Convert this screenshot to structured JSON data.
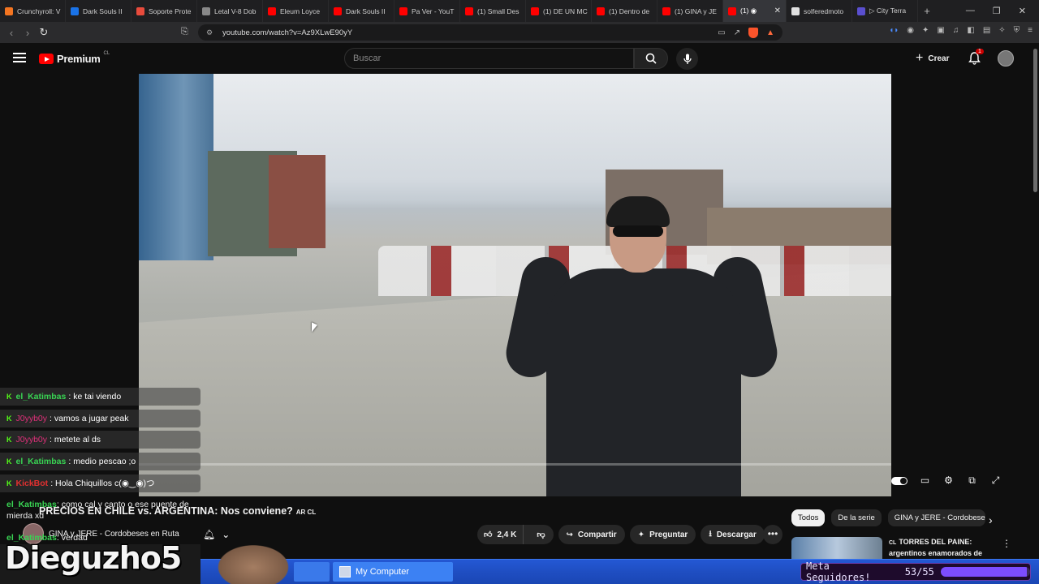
{
  "browser": {
    "tabs": [
      {
        "title": "Crunchyroll: V",
        "color": "#f47521"
      },
      {
        "title": "Dark Souls II",
        "color": "#1a73e8"
      },
      {
        "title": "Soporte Prote",
        "color": "#e84b3c"
      },
      {
        "title": "Letal V-8 Dob",
        "color": "#888888"
      },
      {
        "title": "Eleum Loyce",
        "color": "#ff0000"
      },
      {
        "title": "Dark Souls II",
        "color": "#ff0000"
      },
      {
        "title": "Pa Ver - YouT",
        "color": "#ff0000"
      },
      {
        "title": "(1) Small Des",
        "color": "#ff0000"
      },
      {
        "title": "(1) DE UN MC",
        "color": "#ff0000"
      },
      {
        "title": "(1) Dentro de",
        "color": "#ff0000"
      },
      {
        "title": "(1) GINA y JE",
        "color": "#ff0000"
      },
      {
        "title": "(1) ◉",
        "color": "#ff0000",
        "active": true
      },
      {
        "title": "solferedmoto",
        "color": "#e0e0e0"
      },
      {
        "title": "▷ City Terra",
        "color": "#5a4fcf"
      }
    ],
    "new_tab": "+",
    "url": "youtube.com/watch?v=Az9XLwE90yY"
  },
  "youtube": {
    "logo_text": "Premium",
    "country": "CL",
    "search_placeholder": "Buscar",
    "create_label": "Crear",
    "notification_count": "1"
  },
  "chat": [
    {
      "user": "el_Katimbas",
      "style": "u1",
      "message": ": ke tai viendo"
    },
    {
      "user": "J0yyb0y",
      "style": "u2",
      "message": ": vamos a jugar peak"
    },
    {
      "user": "J0yyb0y",
      "style": "u2",
      "message": ": metete al ds"
    },
    {
      "user": "el_Katimbas",
      "style": "u1",
      "message": ": medio pescao ;o"
    },
    {
      "user": "KickBot",
      "style": "u3",
      "message": ": Hola Chiquillos c(◉‿◉)つ"
    }
  ],
  "chat_multi": {
    "user": "el_Katimbas",
    "message": ": como cal y canto o ese puente de mierda xd"
  },
  "chat_last": {
    "user": "el_Katimbas",
    "message": ": verdad"
  },
  "video": {
    "title": "PRECIOS EN CHILE vs. ARGENTINA: Nos conviene?",
    "flags": "AR CL",
    "channel": "GINA y JERE - Cordobeses en Ruta",
    "likes": "2,4 K",
    "share_label": "Compartir",
    "ask_label": "Preguntar",
    "download_label": "Descargar"
  },
  "recommendation_chips": [
    "Todos",
    "De la serie",
    "GINA y JERE - Cordobeses"
  ],
  "recommendation": {
    "title": "TORRES DEL PAINE: argentinos enamorados de ...",
    "flag": "CL"
  },
  "taskbar": {
    "item": "My Computer"
  },
  "stream_overlay": {
    "streamer_name": "Dieguzho5",
    "goal_label": "Meta Seguidores!",
    "goal_current": 53,
    "goal_target": 55,
    "goal_text": "53/55"
  }
}
